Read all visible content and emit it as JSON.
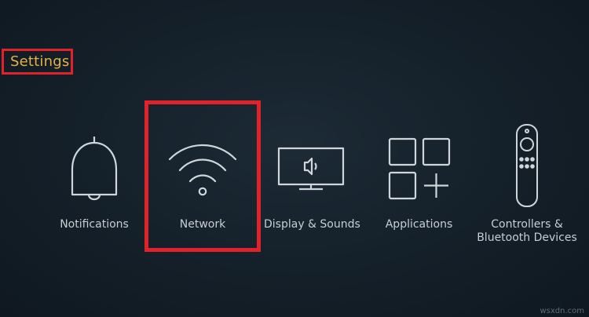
{
  "header": {
    "title": "Settings"
  },
  "tiles": [
    {
      "name": "notifications",
      "label": "Notifications",
      "icon": "bell-icon"
    },
    {
      "name": "network",
      "label": "Network",
      "icon": "wifi-icon",
      "selected": true
    },
    {
      "name": "display-sounds",
      "label": "Display & Sounds",
      "icon": "tv-speaker-icon"
    },
    {
      "name": "applications",
      "label": "Applications",
      "icon": "apps-grid-icon"
    },
    {
      "name": "controllers-bluetooth",
      "label": "Controllers & Bluetooth Devices",
      "icon": "remote-icon"
    }
  ],
  "watermark": "wsxdn.com",
  "colors": {
    "highlight": "#e0222a",
    "title": "#e6b04a",
    "label": "#c7ced4",
    "icon_stroke": "#cfd6db"
  }
}
